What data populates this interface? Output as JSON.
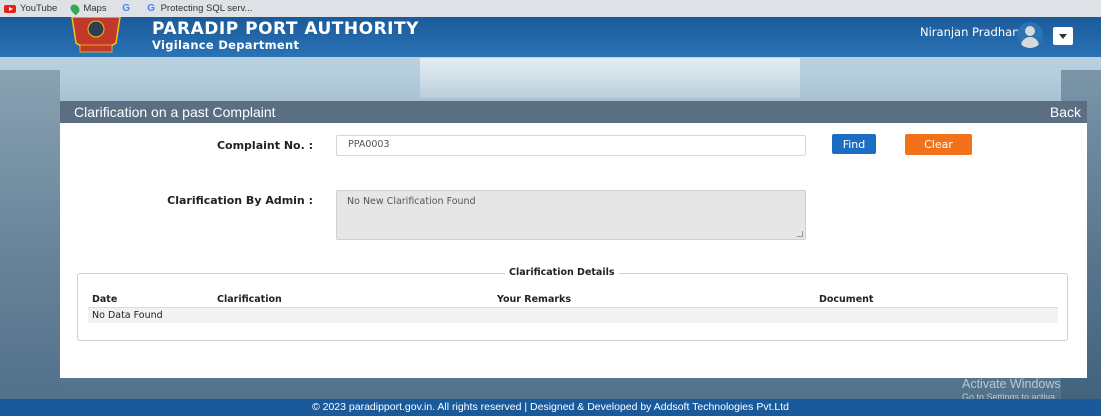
{
  "bookmarks": [
    {
      "label": "YouTube",
      "icon": "youtube-icon"
    },
    {
      "label": "Maps",
      "icon": "maps-icon"
    },
    {
      "label": "",
      "icon": "google-icon"
    },
    {
      "label": "Protecting SQL serv...",
      "icon": "google-icon"
    }
  ],
  "header": {
    "org_title": "PARADIP PORT AUTHORITY",
    "org_subtitle": "Vigilance Department",
    "user_name": "Niranjan Pradhan"
  },
  "panel": {
    "title": "Clarification on a past Complaint",
    "back_label": "Back",
    "complaint_label": "Complaint No. :",
    "complaint_value": "PPA0003",
    "find_label": "Find",
    "clear_label": "Clear",
    "clarification_label": "Clarification By Admin :",
    "clarification_value": "No New Clarification Found"
  },
  "details": {
    "legend": "Clarification Details",
    "columns": [
      "Date",
      "Clarification",
      "Your Remarks",
      "Document"
    ],
    "empty_text": "No Data Found"
  },
  "footer": {
    "text": "© 2023 paradipport.gov.in. All rights reserved | Designed & Developed by Addsoft Technologies Pvt.Ltd"
  },
  "watermark": {
    "line1": "Activate Windows",
    "line2": "Go to Settings to activa"
  },
  "colors": {
    "header_blue": "#1b5a9a",
    "panel_header": "#5a6f82",
    "find_button": "#1b6ec2",
    "clear_button": "#f2721c"
  }
}
